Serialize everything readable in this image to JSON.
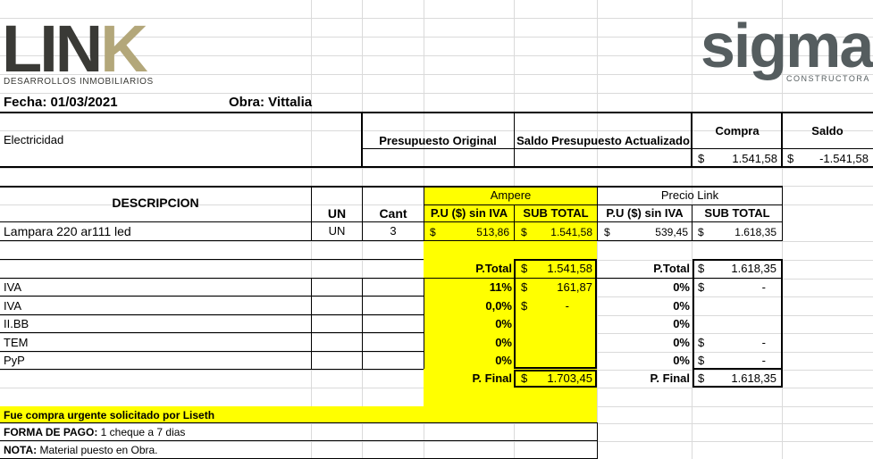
{
  "logos": {
    "link_main": "LIN",
    "link_k": "K",
    "link_sub": "DESARROLLOS INMOBILIARIOS",
    "sigma_main": "sigma",
    "sigma_sub": "CONSTRUCTORA"
  },
  "header": {
    "fecha": "Fecha: 01/03/2021",
    "obra": "Obra:  Vittalia"
  },
  "summary": {
    "rubro": "Electricidad",
    "presupuesto_original_label": "Presupuesto Original",
    "saldo_actualizado_label": "Saldo Presupuesto Actualizado",
    "compra_label": "Compra",
    "saldo_label": "Saldo",
    "compra_currency": "$",
    "compra_value": "1.541,58",
    "saldo_currency": "$",
    "saldo_value": "-1.541,58"
  },
  "table": {
    "descripcion_label": "DESCRIPCION",
    "un_label": "UN",
    "cant_label": "Cant",
    "ampere_label": "Ampere",
    "precio_link_label": "Precio Link",
    "pu_label": "P.U ($) sin IVA",
    "subtotal_label": "SUB TOTAL",
    "pu_label_2": "P.U ($) sin IVA",
    "subtotal_label_2": "SUB TOTAL",
    "row": {
      "descripcion": "Lampara 220 ar111 led",
      "un": "UN",
      "cant": "3",
      "ampere_pu_cur": "$",
      "ampere_pu": "513,86",
      "ampere_sub_cur": "$",
      "ampere_sub": "1.541,58",
      "link_pu_cur": "$",
      "link_pu": "539,45",
      "link_sub_cur": "$",
      "link_sub": "1.618,35"
    }
  },
  "totals": {
    "ptotal_label": "P.Total",
    "ampere_ptotal_cur": "$",
    "ampere_ptotal": "1.541,58",
    "ptotal_label_2": "P.Total",
    "link_ptotal_cur": "$",
    "link_ptotal": "1.618,35",
    "taxes": [
      {
        "name": "IVA",
        "ampere_pct": "11%",
        "ampere_cur": "$",
        "ampere_val": "161,87",
        "link_pct": "0%",
        "link_cur": "$",
        "link_val": "-"
      },
      {
        "name": "IVA",
        "ampere_pct": "0,0%",
        "ampere_cur": "$",
        "ampere_val": "-",
        "link_pct": "0%",
        "link_cur": "",
        "link_val": ""
      },
      {
        "name": "II.BB",
        "ampere_pct": "0%",
        "ampere_cur": "",
        "ampere_val": "",
        "link_pct": "0%",
        "link_cur": "",
        "link_val": ""
      },
      {
        "name": "TEM",
        "ampere_pct": "0%",
        "ampere_cur": "",
        "ampere_val": "",
        "link_pct": "0%",
        "link_cur": "$",
        "link_val": "-"
      },
      {
        "name": "PyP",
        "ampere_pct": "0%",
        "ampere_cur": "",
        "ampere_val": "",
        "link_pct": "0%",
        "link_cur": "$",
        "link_val": "-"
      }
    ],
    "pfinal_label": "P. Final",
    "ampere_pfinal_cur": "$",
    "ampere_pfinal": "1.703,45",
    "pfinal_label_2": "P. Final",
    "link_pfinal_cur": "$",
    "link_pfinal": "1.618,35"
  },
  "notes": {
    "urgent": "Fue compra urgente solicitado por Liseth",
    "forma_pago_label": "FORMA DE PAGO:",
    "forma_pago_value": " 1 cheque a 7 dias",
    "nota_label": "NOTA:",
    "nota_value": " Material puesto en Obra."
  }
}
